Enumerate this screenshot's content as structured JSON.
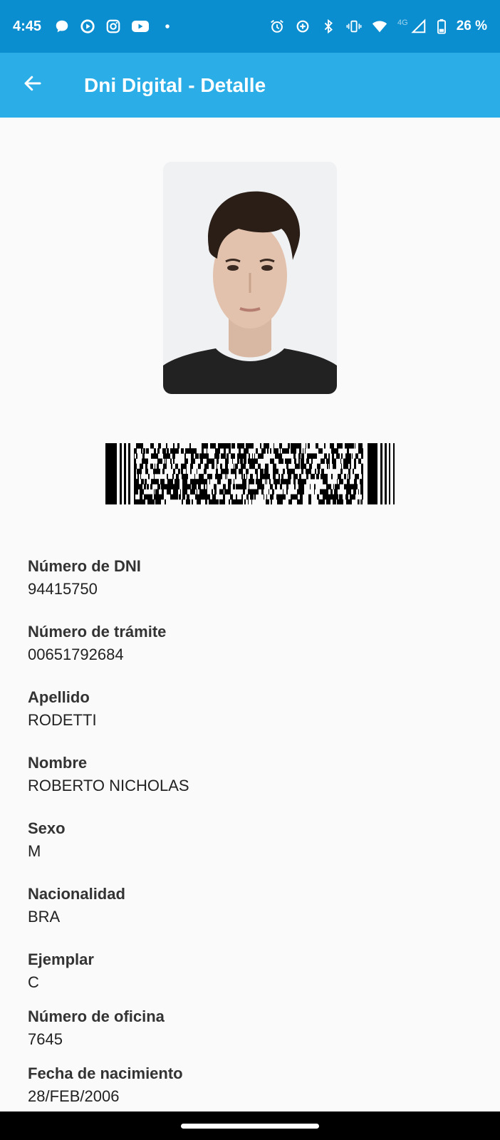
{
  "status_bar": {
    "time": "4:45",
    "battery": "26 %",
    "network": "4G",
    "left_icons": [
      "chat-bubble-icon",
      "play-circle-icon",
      "instagram-icon",
      "youtube-icon",
      "dot-icon"
    ],
    "right_icons": [
      "alarm-icon",
      "data-saver-icon",
      "bluetooth-icon",
      "vibrate-icon",
      "wifi-icon",
      "signal-icon",
      "battery-icon"
    ]
  },
  "app_bar": {
    "title": "Dni Digital - Detalle",
    "back_icon": "arrow-left-icon",
    "color": "#2bade7"
  },
  "fields": [
    {
      "label": "Número de DNI",
      "value": "94415750"
    },
    {
      "label": "Número de trámite",
      "value": "00651792684"
    },
    {
      "label": "Apellido",
      "value": "RODETTI"
    },
    {
      "label": "Nombre",
      "value": "ROBERTO NICHOLAS"
    },
    {
      "label": "Sexo",
      "value": "M"
    },
    {
      "label": "Nacionalidad",
      "value": "BRA"
    },
    {
      "label": "Ejemplar",
      "value": "C"
    },
    {
      "label": "Número de oficina",
      "value": "7645"
    },
    {
      "label": "Fecha de nacimiento",
      "value": "28/FEB/2006"
    }
  ]
}
